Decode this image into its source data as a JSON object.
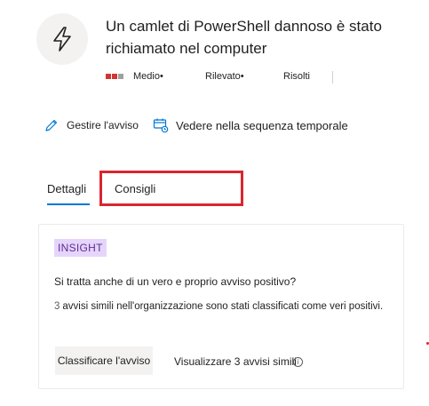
{
  "alert": {
    "title": "Un camlet di PowerShell dannoso è stato richiamato nel computer",
    "icon": "lightning-bolt-icon",
    "severity": "Medio•",
    "severity_colors": [
      "#d13438",
      "#d13438",
      "#a19f9d"
    ],
    "detection": "Rilevato•",
    "resolved": "Risolti"
  },
  "actions": {
    "manage_label": "Gestire l'avviso",
    "manage_icon": "pencil-icon",
    "timeline_label": "Vedere nella sequenza temporale",
    "timeline_icon": "timeline-icon"
  },
  "tabs": [
    {
      "label": "Dettagli",
      "selected": true
    },
    {
      "label": "Consigli",
      "selected": false,
      "highlighted": true
    }
  ],
  "insight_card": {
    "badge": "INSIGHT",
    "question": "Si tratta anche di un vero e proprio avviso positivo?",
    "count": "3",
    "description": "avvisi simili nell'organizzazione sono stati classificati come veri positivi.",
    "classify_button": "Classificare l'avviso",
    "view_link": "Visualizzare 3 avvisi simili",
    "info_icon": "info-icon"
  },
  "colors": {
    "accent": "#0078d4",
    "highlight": "#d9262f",
    "insight_bg": "#e6d5fb",
    "insight_text": "#5c2d91"
  }
}
